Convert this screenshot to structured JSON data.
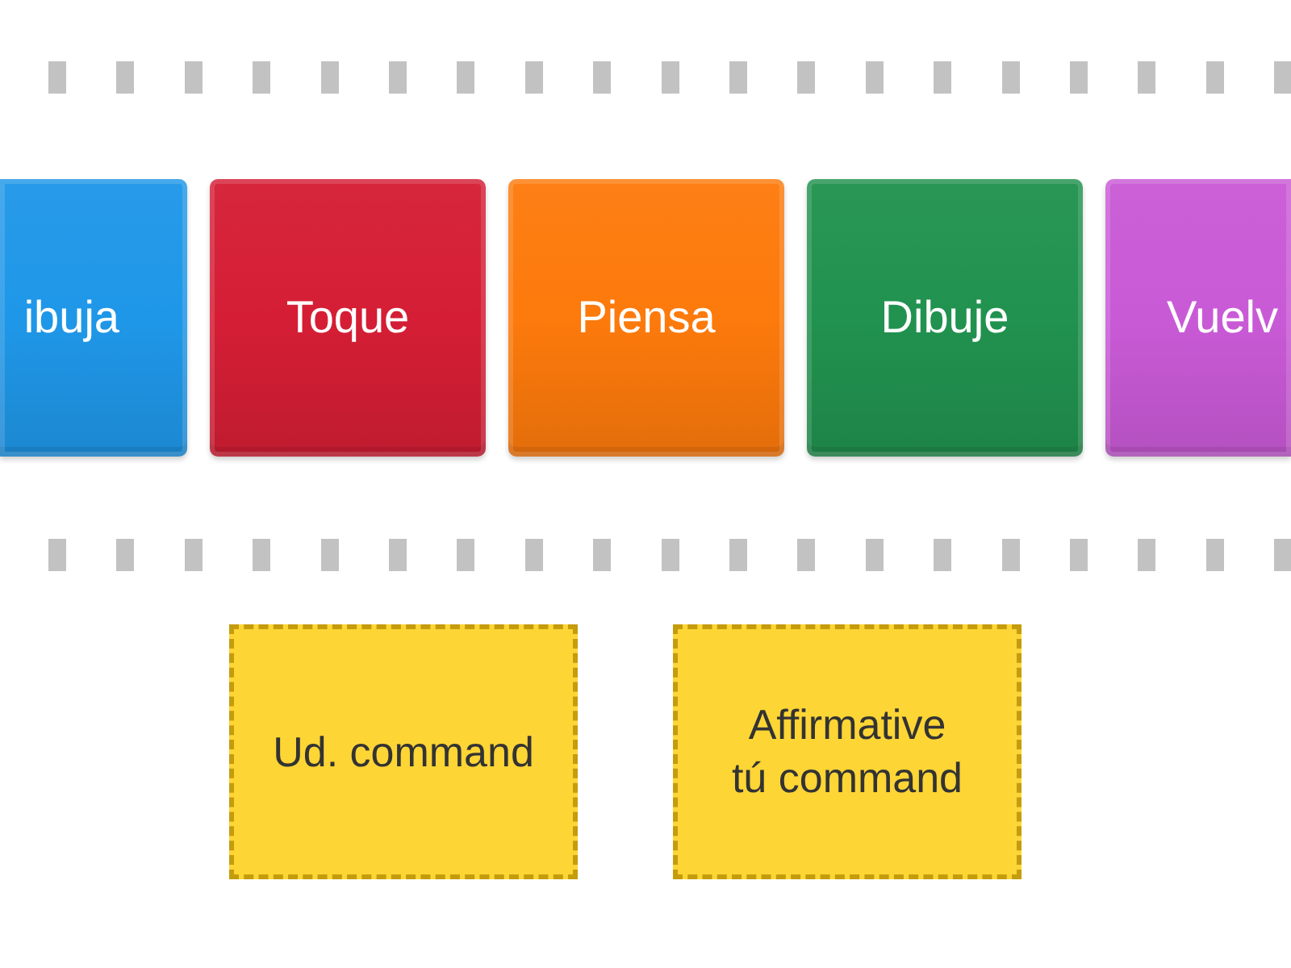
{
  "cards": [
    {
      "label": "ibuja",
      "color": "#1f97e8",
      "kind": "start"
    },
    {
      "label": "Toque",
      "color": "#d51e35",
      "kind": "full"
    },
    {
      "label": "Piensa",
      "color": "#fd7a0c",
      "kind": "full"
    },
    {
      "label": "Dibuje",
      "color": "#21924f",
      "kind": "full"
    },
    {
      "label": "Vuelv",
      "color": "#c95ad6",
      "kind": "end"
    }
  ],
  "answers": [
    {
      "label": "Ud. command"
    },
    {
      "label": "Affirmative tú command"
    }
  ]
}
